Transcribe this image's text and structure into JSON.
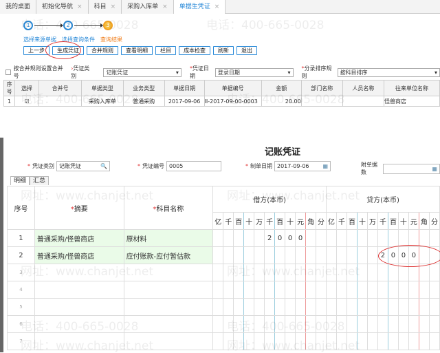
{
  "tabs": [
    {
      "label": "我的桌面",
      "closable": false
    },
    {
      "label": "初始化导航",
      "closable": true
    },
    {
      "label": "科目",
      "closable": true
    },
    {
      "label": "采购入库单",
      "closable": true
    },
    {
      "label": "单据生凭证",
      "closable": true,
      "active": true
    }
  ],
  "steps": [
    {
      "num": "1",
      "label": "选择来源单据"
    },
    {
      "num": "2",
      "label": "选择查询条件"
    },
    {
      "num": "3",
      "label": "查询结果",
      "current": true
    }
  ],
  "buttons": [
    "上一步",
    "生成凭证",
    "合并规则",
    "查看明细",
    "栏目",
    "成本检查",
    "刷新",
    "退出"
  ],
  "filter": {
    "merge_checkbox": "按合并规则设置合并号",
    "voucher_type_label": "凭证类别",
    "voucher_type": "记账凭证",
    "voucher_date_label": "凭证日期",
    "voucher_date": "登录日期",
    "entry_sort_label": "分录排序规则",
    "entry_sort": "按科目排序"
  },
  "grid": {
    "columns": [
      "序号",
      "选择",
      "合并号",
      "单据类型",
      "业务类型",
      "单据日期",
      "单据编号",
      "金额",
      "部门名称",
      "人员名称",
      "往来单位名称"
    ],
    "rows": [
      {
        "seq": "1",
        "checked": true,
        "merge": "",
        "doc_type": "采购入库单",
        "biz_type": "普通采购",
        "date": "2017-09-06",
        "doc_no": "II-2017-09-00-0003",
        "amount": "20.00",
        "dept": "",
        "person": "",
        "partner": "怪兽商店"
      }
    ]
  },
  "voucher": {
    "title": "记账凭证",
    "type_label": "凭证类别",
    "type": "记账凭证",
    "no_label": "凭证编号",
    "no": "0005",
    "date_label": "制单日期",
    "date": "2017-09-06",
    "attach_label": "附单据数",
    "attach": "",
    "subtabs": [
      "明细",
      "汇总"
    ],
    "col_seq": "序号",
    "col_summary": "摘要",
    "col_account": "科目名称",
    "col_debit": "借方(本币)",
    "col_credit": "贷方(本币)",
    "digits": [
      "亿",
      "千",
      "百",
      "十",
      "万",
      "千",
      "百",
      "十",
      "元",
      "角",
      "分"
    ],
    "rows": [
      {
        "seq": "1",
        "summary": "普通采购/怪兽商店",
        "account": "原材料",
        "debit": "2000",
        "credit": ""
      },
      {
        "seq": "2",
        "summary": "普通采购/怪兽商店",
        "account": "应付账款-应付暂估款",
        "debit": "",
        "credit": "2000"
      },
      {
        "seq": "3"
      },
      {
        "seq": "4"
      },
      {
        "seq": "5"
      },
      {
        "seq": "6"
      },
      {
        "seq": "7"
      }
    ]
  },
  "watermark": {
    "phone": "电话：400-665-0028",
    "site": "网址：www.chanjet.net"
  }
}
